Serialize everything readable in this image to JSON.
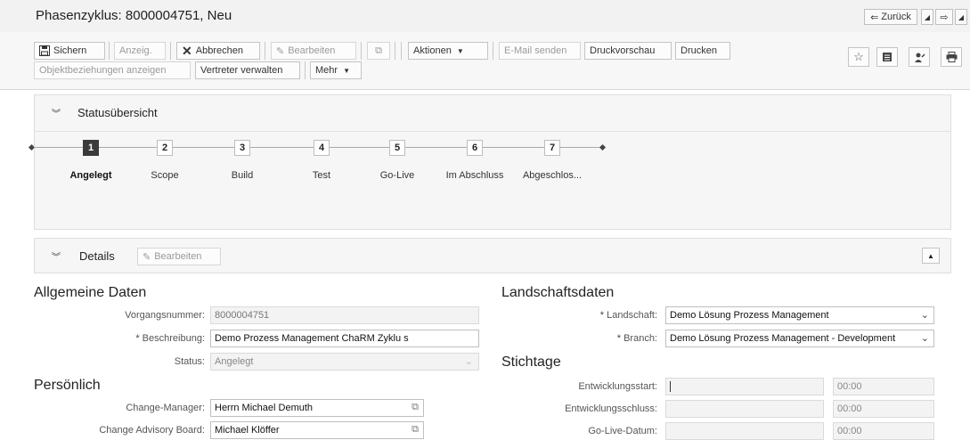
{
  "header": {
    "title": "Phasenzyklus: 8000004751, Neu",
    "back_label": "Zurück",
    "back_icon": "arrow-left-icon"
  },
  "toolbar": {
    "save_label": "Sichern",
    "display_label": "Anzeig.",
    "cancel_label": "Abbrechen",
    "edit_label": "Bearbeiten",
    "actions_label": "Aktionen",
    "email_label": "E-Mail senden",
    "preview_label": "Druckvorschau",
    "print_label": "Drucken",
    "relations_label": "Objektbeziehungen anzeigen",
    "delegates_label": "Vertreter verwalten",
    "more_label": "Mehr"
  },
  "status_panel": {
    "title": "Statusübersicht",
    "steps": [
      {
        "num": "1",
        "label": "Angelegt",
        "active": true
      },
      {
        "num": "2",
        "label": "Scope"
      },
      {
        "num": "3",
        "label": "Build"
      },
      {
        "num": "4",
        "label": "Test"
      },
      {
        "num": "5",
        "label": "Go-Live"
      },
      {
        "num": "6",
        "label": "Im Abschluss"
      },
      {
        "num": "7",
        "label": "Abgeschlos..."
      }
    ]
  },
  "details_panel": {
    "title": "Details",
    "edit_label": "Bearbeiten"
  },
  "general": {
    "section_title": "Allgemeine Daten",
    "transaction_label": "Vorgangsnummer:",
    "transaction_value": "8000004751",
    "description_label": "Beschreibung:",
    "description_value": "Demo Prozess Management ChaRM Zyklu s",
    "status_label": "Status:",
    "status_value": "Angelegt"
  },
  "personal": {
    "section_title": "Persönlich",
    "change_manager_label": "Change-Manager:",
    "change_manager_value": "Herrn Michael Demuth",
    "cab_label": "Change Advisory Board:",
    "cab_value": "Michael Klöffer"
  },
  "landscape": {
    "section_title": "Landschaftsdaten",
    "landscape_label": "Landschaft:",
    "landscape_value": "Demo Lösung Prozess Management",
    "branch_label": "Branch:",
    "branch_value": "Demo Lösung Prozess Management - Development"
  },
  "dates": {
    "section_title": "Stichtage",
    "dev_start_label": "Entwicklungsstart:",
    "dev_start_time": "00:00",
    "dev_end_label": "Entwicklungsschluss:",
    "dev_end_time": "00:00",
    "golive_label": "Go-Live-Datum:",
    "golive_time": "00:00"
  },
  "required_marker": "*"
}
